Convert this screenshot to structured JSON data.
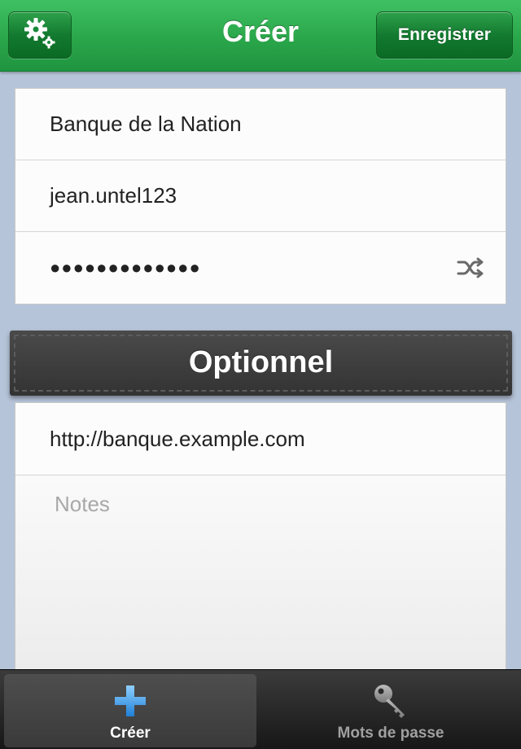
{
  "navbar": {
    "title": "Créer",
    "save_label": "Enregistrer",
    "settings_icon": "gear-icon"
  },
  "form": {
    "name_value": "Banque de la Nation",
    "username_value": "jean.untel123",
    "password_masked": "●●●●●●●●●●●●●",
    "generate_icon": "shuffle-icon"
  },
  "optional": {
    "section_label": "Optionnel",
    "url_value": "http://banque.example.com",
    "notes_placeholder": "Notes"
  },
  "tabbar": {
    "tabs": [
      {
        "label": "Créer",
        "icon": "plus-icon",
        "selected": true
      },
      {
        "label": "Mots de passe",
        "icon": "key-icon",
        "selected": false
      }
    ]
  },
  "colors": {
    "navbar_green": "#2aa64a",
    "background": "#b6c4d9",
    "plus_blue": "#3aa0e8"
  }
}
